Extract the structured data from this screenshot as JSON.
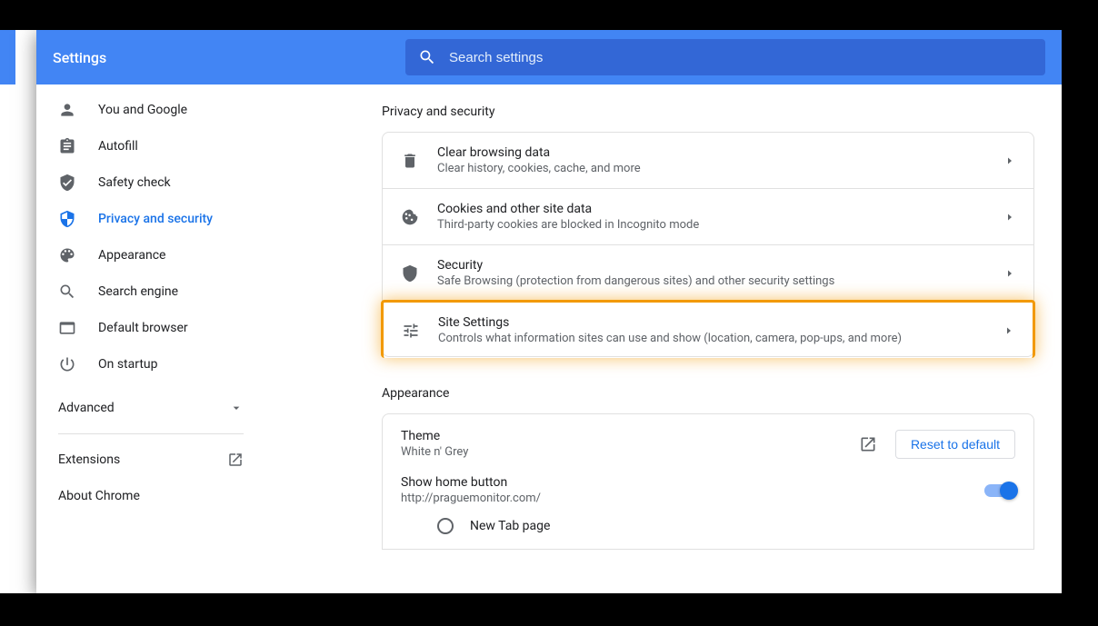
{
  "header": {
    "title": "Settings",
    "search_placeholder": "Search settings"
  },
  "sidebar": {
    "items": [
      {
        "label": "You and Google"
      },
      {
        "label": "Autofill"
      },
      {
        "label": "Safety check"
      },
      {
        "label": "Privacy and security"
      },
      {
        "label": "Appearance"
      },
      {
        "label": "Search engine"
      },
      {
        "label": "Default browser"
      },
      {
        "label": "On startup"
      }
    ],
    "advanced": "Advanced",
    "extensions": "Extensions",
    "about": "About Chrome"
  },
  "privacy": {
    "title": "Privacy and security",
    "rows": [
      {
        "title": "Clear browsing data",
        "sub": "Clear history, cookies, cache, and more"
      },
      {
        "title": "Cookies and other site data",
        "sub": "Third-party cookies are blocked in Incognito mode"
      },
      {
        "title": "Security",
        "sub": "Safe Browsing (protection from dangerous sites) and other security settings"
      },
      {
        "title": "Site Settings",
        "sub": "Controls what information sites can use and show (location, camera, pop-ups, and more)"
      }
    ]
  },
  "appearance": {
    "title": "Appearance",
    "theme_label": "Theme",
    "theme_value": "White n' Grey",
    "reset": "Reset to default",
    "home_label": "Show home button",
    "home_value": "http://praguemonitor.com/",
    "newtab": "New Tab page"
  }
}
